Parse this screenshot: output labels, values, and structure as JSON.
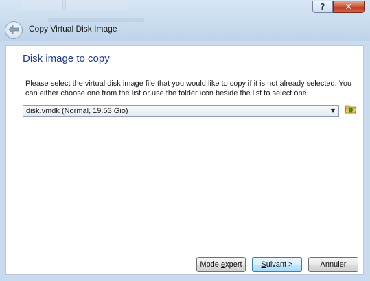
{
  "window": {
    "help_label": "?",
    "close_label": "✕",
    "wizard_title": "Copy Virtual Disk Image"
  },
  "page": {
    "title": "Disk image to copy",
    "description": "Please select the virtual disk image file that you would like to copy if it is not already selected. You can either choose one from the list or use the folder icon beside the list to select one."
  },
  "disk_select": {
    "value": "disk.vmdk (Normal, 19.53 Gio)",
    "arrow": "▼"
  },
  "buttons": {
    "expert_prefix": "Mode ",
    "expert_mnemonic": "e",
    "expert_suffix": "xpert",
    "next_mnemonic": "S",
    "next_suffix": "uivant >",
    "cancel": "Annuler"
  },
  "colors": {
    "accent_title": "#1e3a8a",
    "close_button": "#c0391f",
    "folder_icon": "#e8b630"
  },
  "icons": {
    "back": "back-arrow-icon",
    "folder": "folder-up-icon"
  }
}
